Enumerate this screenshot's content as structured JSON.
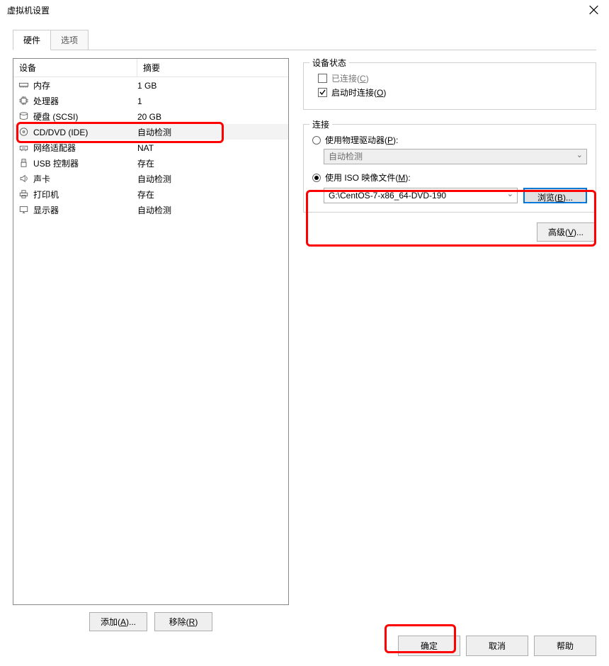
{
  "window": {
    "title": "虚拟机设置"
  },
  "tabs": {
    "hardware": "硬件",
    "options": "选项"
  },
  "headers": {
    "device": "设备",
    "summary": "摘要"
  },
  "devices": [
    {
      "icon": "memory-icon",
      "name": "内存",
      "summary": "1 GB"
    },
    {
      "icon": "cpu-icon",
      "name": "处理器",
      "summary": "1"
    },
    {
      "icon": "disk-icon",
      "name": "硬盘 (SCSI)",
      "summary": "20 GB"
    },
    {
      "icon": "disc-icon",
      "name": "CD/DVD (IDE)",
      "summary": "自动检测"
    },
    {
      "icon": "network-icon",
      "name": "网络适配器",
      "summary": "NAT"
    },
    {
      "icon": "usb-icon",
      "name": "USB 控制器",
      "summary": "存在"
    },
    {
      "icon": "sound-icon",
      "name": "声卡",
      "summary": "自动检测"
    },
    {
      "icon": "printer-icon",
      "name": "打印机",
      "summary": "存在"
    },
    {
      "icon": "display-icon",
      "name": "显示器",
      "summary": "自动检测"
    }
  ],
  "buttons": {
    "add": "添加",
    "add_key": "A",
    "remove": "移除",
    "remove_key": "R",
    "advanced": "高级",
    "advanced_key": "V",
    "browse": "浏览",
    "browse_key": "B",
    "ok": "确定",
    "cancel": "取消",
    "help": "帮助"
  },
  "status_group": {
    "title": "设备状态",
    "connected": "已连接",
    "connected_key": "C",
    "connect_on_start": "启动时连接",
    "connect_on_start_key": "O"
  },
  "conn_group": {
    "title": "连接",
    "use_physical": "使用物理驱动器",
    "use_physical_key": "P",
    "autodetect": "自动检测",
    "use_iso": "使用 ISO 映像文件",
    "use_iso_key": "M",
    "iso_path": "G:\\CentOS-7-x86_64-DVD-190"
  }
}
